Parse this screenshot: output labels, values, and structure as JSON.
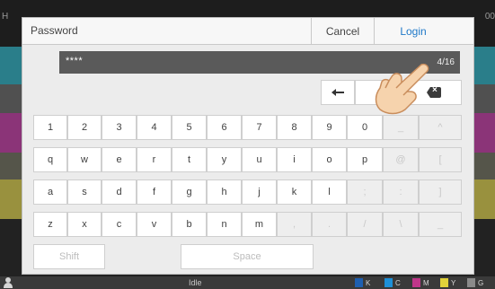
{
  "background": {
    "left_edge_text": "H",
    "right_edge_text": "00",
    "status_text": "Idle",
    "ink_labels": [
      "K",
      "C",
      "M",
      "Y"
    ],
    "ink_colors": [
      "#1a1a1a",
      "#1e90d8",
      "#c0368a",
      "#e2d23a"
    ],
    "trailing_label": "G"
  },
  "dialog": {
    "title": "Password",
    "cancel_label": "Cancel",
    "login_label": "Login",
    "password_value": "****",
    "char_count": "4/16"
  },
  "keyboard": {
    "row1": [
      "1",
      "2",
      "3",
      "4",
      "5",
      "6",
      "7",
      "8",
      "9",
      "0",
      "_",
      "^"
    ],
    "row2": [
      "q",
      "w",
      "e",
      "r",
      "t",
      "y",
      "u",
      "i",
      "o",
      "p",
      "@",
      "["
    ],
    "row3": [
      "a",
      "s",
      "d",
      "f",
      "g",
      "h",
      "j",
      "k",
      "l",
      ";",
      ":",
      "]"
    ],
    "row4": [
      "z",
      "x",
      "c",
      "v",
      "b",
      "n",
      "m",
      ",",
      ".",
      "/",
      "\\",
      "_"
    ],
    "shift_label": "Shift",
    "space_label": "Space"
  },
  "colors": {
    "accent": "#1e78c8",
    "field_bg": "#5a5a5a"
  }
}
